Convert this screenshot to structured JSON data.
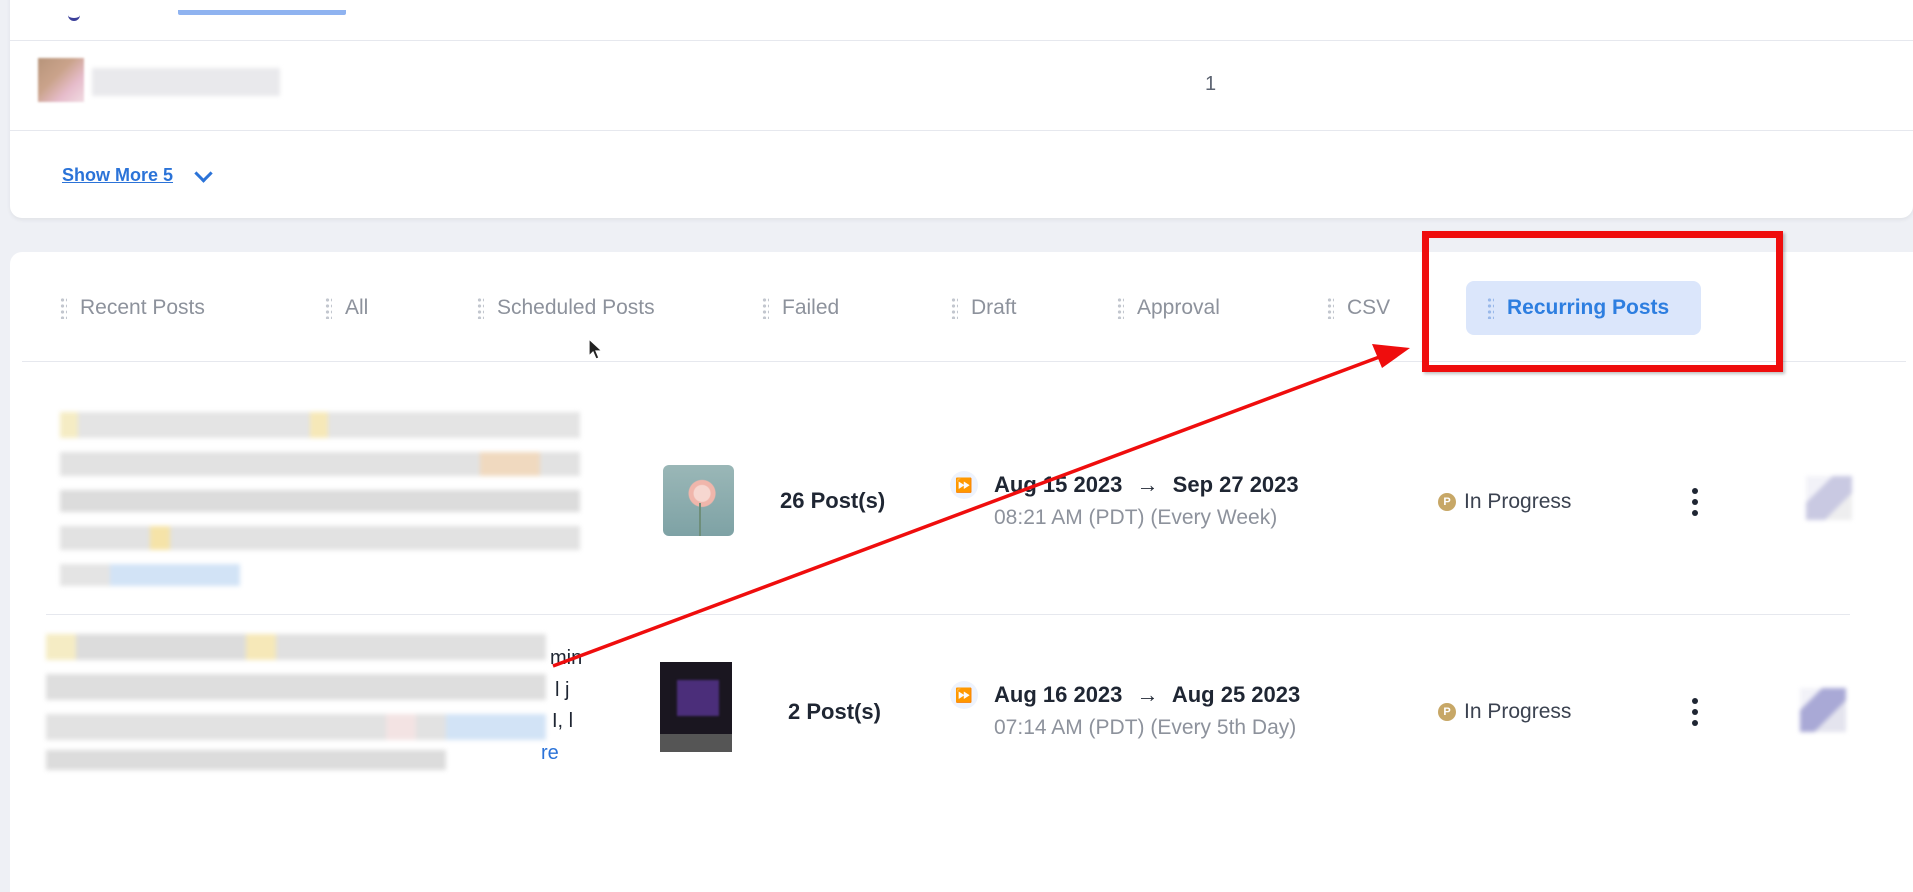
{
  "top_card": {
    "count": "1",
    "show_more_label": "Show More 5"
  },
  "tabs": [
    {
      "label": "Recent Posts",
      "active": false
    },
    {
      "label": "All",
      "active": false
    },
    {
      "label": "Scheduled Posts",
      "active": false
    },
    {
      "label": "Failed",
      "active": false
    },
    {
      "label": "Draft",
      "active": false
    },
    {
      "label": "Approval",
      "active": false
    },
    {
      "label": "CSV",
      "active": false
    },
    {
      "label": "Recurring Posts",
      "active": true
    }
  ],
  "rows": [
    {
      "post_count": "26 Post(s)",
      "start_date": "Aug 15 2023",
      "arrow": "→",
      "end_date": "Sep 27 2023",
      "time": "08:21 AM (PDT) (Every Week)",
      "status": "In Progress",
      "status_icon": "P"
    },
    {
      "post_count": "2 Post(s)",
      "start_date": "Aug 16 2023",
      "arrow": "→",
      "end_date": "Aug 25 2023",
      "time": "07:14 AM (PDT) (Every 5th Day)",
      "status": "In Progress",
      "status_icon": "P",
      "text_fragments": [
        "min",
        "l j",
        "I, l"
      ],
      "read_more_fragment": "re"
    }
  ],
  "colors": {
    "accent": "#2d7ee0",
    "active_tab_bg": "#dbe6fb",
    "annotation": "#ef0d0d",
    "status_dot": "#c7a766"
  }
}
